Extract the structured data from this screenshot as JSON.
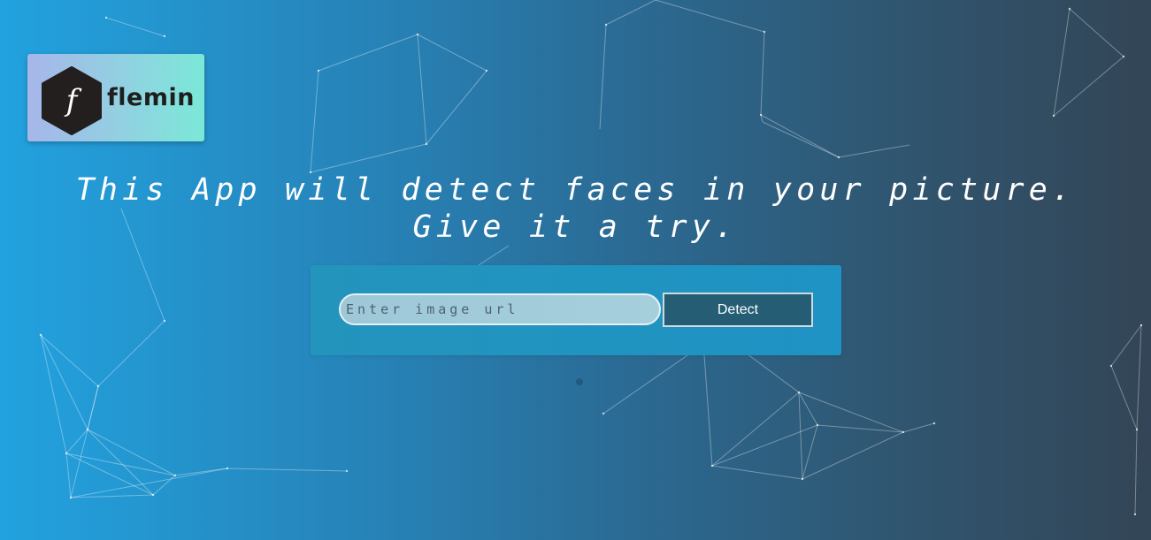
{
  "brand": {
    "logo_letter": "f",
    "name": "flemin"
  },
  "hero": {
    "line1": "This App will detect faces in your picture.",
    "line2": "Give it a try."
  },
  "form": {
    "input_placeholder": "Enter image url",
    "input_value": "",
    "detect_label": "Detect"
  },
  "colors": {
    "background_start": "#22a2df",
    "background_end": "#334556",
    "button": "#255d75",
    "logo_card_start": "#a7b6ea",
    "logo_card_end": "#7be8d8"
  }
}
